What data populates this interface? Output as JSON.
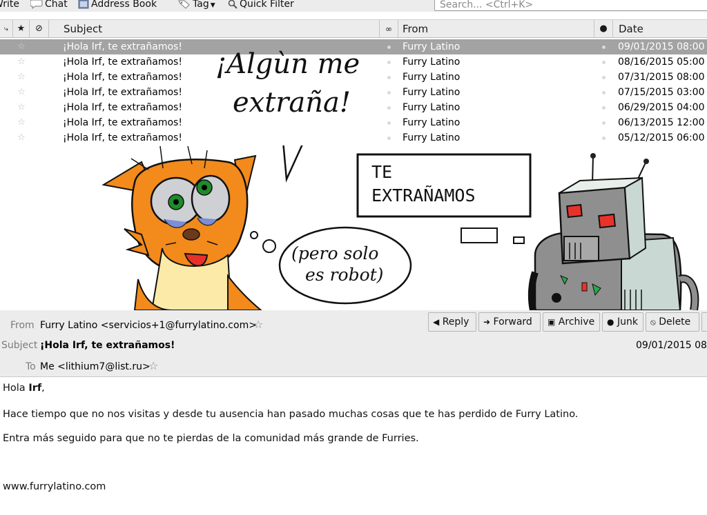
{
  "toolbar": {
    "write_label": "Write",
    "chat_label": "Chat",
    "addressbook_label": "Address Book",
    "tag_label": "Tag",
    "quickfilter_label": "Quick Filter",
    "search_placeholder": "Search... <Ctrl+K>"
  },
  "columns": {
    "subject": "Subject",
    "from": "From",
    "date": "Date"
  },
  "messages": [
    {
      "subject": "¡Hola Irf, te extrañamos!",
      "from": "Furry Latino",
      "date": "09/01/2015 08:00"
    },
    {
      "subject": "¡Hola Irf, te extrañamos!",
      "from": "Furry Latino",
      "date": "08/16/2015 05:00"
    },
    {
      "subject": "¡Hola Irf, te extrañamos!",
      "from": "Furry Latino",
      "date": "07/31/2015 08:00"
    },
    {
      "subject": "¡Hola Irf, te extrañamos!",
      "from": "Furry Latino",
      "date": "07/15/2015 03:00"
    },
    {
      "subject": "¡Hola Irf, te extrañamos!",
      "from": "Furry Latino",
      "date": "06/29/2015 04:00"
    },
    {
      "subject": "¡Hola Irf, te extrañamos!",
      "from": "Furry Latino",
      "date": "06/13/2015 12:00"
    },
    {
      "subject": "¡Hola Irf, te extrañamos!",
      "from": "Furry Latino",
      "date": "05/12/2015 06:00"
    }
  ],
  "comic": {
    "speech": [
      "¡Algùn me",
      "extraña!"
    ],
    "thought": [
      "(pero solo",
      "es robot)"
    ],
    "sign": [
      "TE",
      "EXTRAÑAMOS"
    ]
  },
  "header": {
    "from_label": "From",
    "from_value": "Furry Latino <servicios+1@furrylatino.com>",
    "subject_label": "Subject",
    "subject_value": "¡Hola Irf, te extrañamos!",
    "to_label": "To",
    "to_value": "Me <lithium7@list.ru>",
    "date_value": "09/01/2015 08"
  },
  "actions": {
    "reply": "Reply",
    "forward": "Forward",
    "archive": "Archive",
    "junk": "Junk",
    "delete": "Delete"
  },
  "body": {
    "greeting_prefix": "Hola ",
    "greeting_name": "Irf",
    "greeting_suffix": ",",
    "para1": "Hace tiempo que no nos visitas y desde tu ausencia han pasado muchas cosas que te has perdido de Furry Latino.",
    "para2": "Entra más seguido para que no te pierdas de la comunidad más grande de Furries.",
    "link": "www.furrylatino.com"
  },
  "colors": {
    "selected_row": "#a3a3a3",
    "chrome": "#ececec",
    "cat_orange": "#f28a1c",
    "robot_gray": "#8f8f8f",
    "robot_eyes": "#e8322a"
  }
}
